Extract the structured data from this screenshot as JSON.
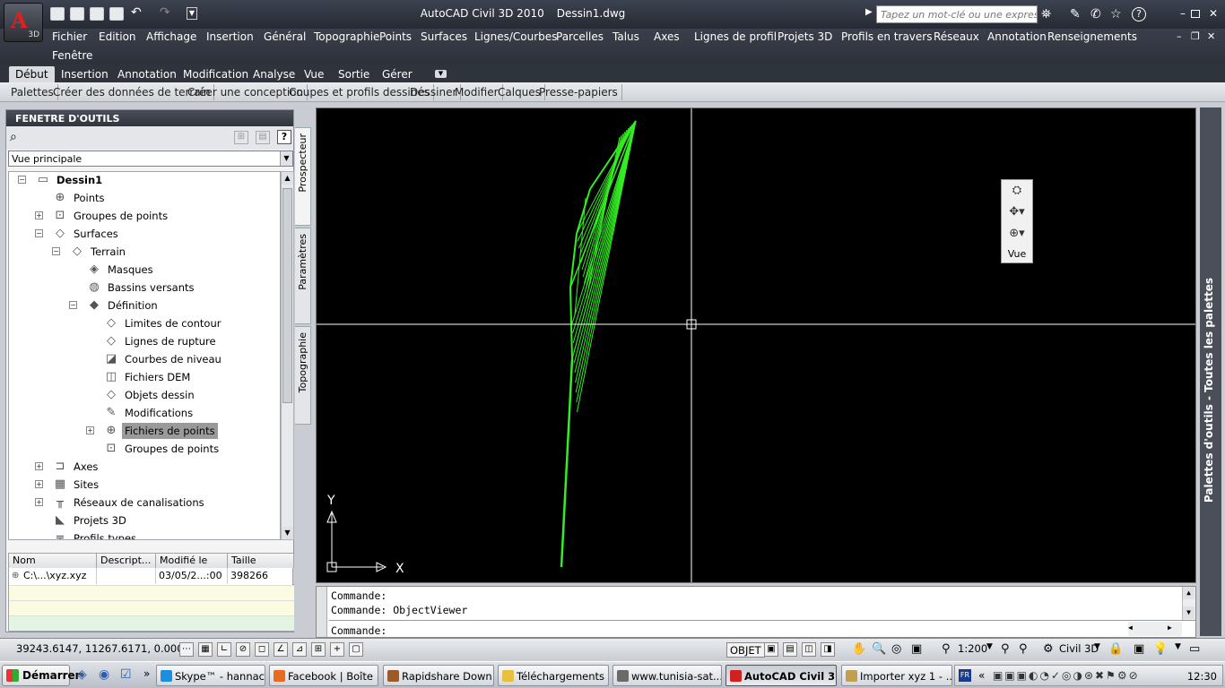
{
  "window": {
    "app_title": "AutoCAD Civil 3D 2010",
    "doc_title": "Dessin1.dwg",
    "app_badge": "3D"
  },
  "search": {
    "placeholder": "Tapez un mot-clé ou une expression"
  },
  "menu": [
    "Fichier",
    "Edition",
    "Affichage",
    "Insertion",
    "Général",
    "Topographie",
    "Points",
    "Surfaces",
    "Lignes/Courbes",
    "Parcelles",
    "Talus",
    "Axes",
    "Lignes de profil",
    "Projets 3D",
    "Profils en travers",
    "Réseaux",
    "Annotation",
    "Renseignements",
    "Fenêtre"
  ],
  "ribbon_tabs": [
    "Début",
    "Insertion",
    "Annotation",
    "Modification",
    "Analyse",
    "Vue",
    "Sortie",
    "Gérer"
  ],
  "ribbon_panels": [
    "Palettes",
    "Créer des données de terrain",
    "Créer une conception",
    "Coupes et profils dessinés",
    "Dessiner",
    "Modifier",
    "Calques",
    "Presse-papiers"
  ],
  "toolspace": {
    "title": "FENETRE D'OUTILS",
    "view_select": "Vue principale",
    "tree": [
      {
        "label": "Dessin1",
        "bold": true,
        "expander": "-",
        "icon": "drawing-icon"
      },
      {
        "label": "Points",
        "icon": "point-icon"
      },
      {
        "label": "Groupes de points",
        "expander": "+",
        "icon": "point-group-icon"
      },
      {
        "label": "Surfaces",
        "expander": "-",
        "icon": "surface-icon"
      },
      {
        "label": "Terrain",
        "expander": "-",
        "icon": "surface-icon"
      },
      {
        "label": "Masques",
        "icon": "mask-icon"
      },
      {
        "label": "Bassins versants",
        "icon": "watershed-icon"
      },
      {
        "label": "Définition",
        "expander": "-",
        "icon": "definition-icon"
      },
      {
        "label": "Limites de contour",
        "icon": "boundary-icon"
      },
      {
        "label": "Lignes de rupture",
        "icon": "breakline-icon"
      },
      {
        "label": "Courbes de niveau",
        "icon": "contour-icon"
      },
      {
        "label": "Fichiers DEM",
        "icon": "dem-icon"
      },
      {
        "label": "Objets dessin",
        "icon": "drawing-object-icon"
      },
      {
        "label": "Modifications",
        "icon": "edit-icon"
      },
      {
        "label": "Fichiers de points",
        "expander": "+",
        "icon": "point-file-icon",
        "selected": true
      },
      {
        "label": "Groupes de points",
        "icon": "point-group-icon"
      },
      {
        "label": "Axes",
        "expander": "+",
        "icon": "alignment-icon"
      },
      {
        "label": "Sites",
        "expander": "+",
        "icon": "site-icon"
      },
      {
        "label": "Réseaux de canalisations",
        "expander": "+",
        "icon": "pipe-network-icon"
      },
      {
        "label": "Projets 3D",
        "icon": "corridor-icon"
      },
      {
        "label": "Profils types",
        "icon": "assembly-icon"
      }
    ],
    "list": {
      "columns": [
        "Nom",
        "Descript...",
        "Modifié le",
        "Taille"
      ],
      "rows": [
        [
          "C:\\...\\xyz.xyz",
          "",
          "03/05/2...:00",
          "398266"
        ]
      ]
    },
    "side_tabs": [
      "Prospecteur",
      "Paramètres",
      "Topographie"
    ]
  },
  "nav": {
    "label": "Vue"
  },
  "axes": {
    "x": "X",
    "y": "Y"
  },
  "right_palette": "Palettes d'outils - Toutes les palettes",
  "command": {
    "history": [
      "Commande:",
      "Commande: ObjectViewer"
    ],
    "prompt": "Commande:"
  },
  "status": {
    "coords": "39243.6147, 11267.6171, 0.0000",
    "objet": "OBJET",
    "scale": "1:200",
    "workspace": "Civil 3D"
  },
  "taskbar": {
    "start": "Démarrer",
    "items": [
      {
        "label": "Skype™ - hannac...",
        "color": "#1a8fe0"
      },
      {
        "label": "Facebook | Boîte ...",
        "color": "#e86a20"
      },
      {
        "label": "Rapidshare Down...",
        "color": "#9a5a2a"
      },
      {
        "label": "Téléchargements",
        "color": "#e8c040"
      },
      {
        "label": "www.tunisia-sat....",
        "color": "#6a6a6a"
      },
      {
        "label": "AutoCAD Civil 3...",
        "color": "#d02020",
        "active": true
      },
      {
        "label": "Importer xyz 1 - ...",
        "color": "#c0a050"
      }
    ],
    "lang": "FR",
    "clock": "12:30"
  }
}
